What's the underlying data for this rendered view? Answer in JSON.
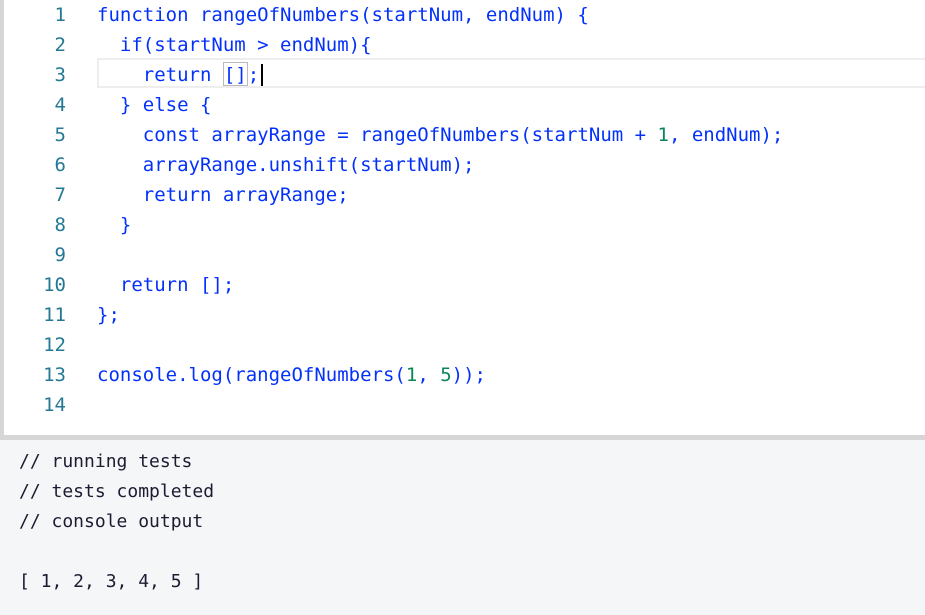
{
  "editor": {
    "lines": [
      {
        "n": "1",
        "parts": [
          {
            "t": "function rangeOfNumbers(startNum, endNum) {"
          }
        ]
      },
      {
        "n": "2",
        "parts": [
          {
            "t": "  if(startNum > endNum){"
          }
        ]
      },
      {
        "n": "3",
        "parts": [
          {
            "t": "    return "
          },
          {
            "t": "[]",
            "box": true
          },
          {
            "t": ";"
          }
        ]
      },
      {
        "n": "4",
        "parts": [
          {
            "t": "  } else {"
          }
        ]
      },
      {
        "n": "5",
        "parts": [
          {
            "t": "    const arrayRange = rangeOfNumbers(startNum + "
          },
          {
            "t": "1",
            "cls": "num"
          },
          {
            "t": ", endNum);"
          }
        ]
      },
      {
        "n": "6",
        "parts": [
          {
            "t": "    arrayRange.unshift(startNum);"
          }
        ]
      },
      {
        "n": "7",
        "parts": [
          {
            "t": "    return arrayRange;"
          }
        ]
      },
      {
        "n": "8",
        "parts": [
          {
            "t": "  }"
          }
        ]
      },
      {
        "n": "9",
        "parts": [
          {
            "t": ""
          }
        ]
      },
      {
        "n": "10",
        "parts": [
          {
            "t": "  return [];"
          }
        ]
      },
      {
        "n": "11",
        "parts": [
          {
            "t": "};"
          }
        ]
      },
      {
        "n": "12",
        "parts": [
          {
            "t": ""
          }
        ]
      },
      {
        "n": "13",
        "parts": [
          {
            "t": "console.log(rangeOfNumbers("
          },
          {
            "t": "1",
            "cls": "num"
          },
          {
            "t": ", "
          },
          {
            "t": "5",
            "cls": "num"
          },
          {
            "t": "));"
          }
        ]
      },
      {
        "n": "14",
        "parts": [
          {
            "t": ""
          }
        ]
      }
    ]
  },
  "output": {
    "lines": [
      "// running tests",
      "// tests completed",
      "// console output",
      "",
      "[ 1, 2, 3, 4, 5 ]"
    ]
  },
  "colors": {
    "keyword": "#0431fa",
    "number": "#098658",
    "line_number": "#237893",
    "console_bg": "#f5f6f7"
  }
}
